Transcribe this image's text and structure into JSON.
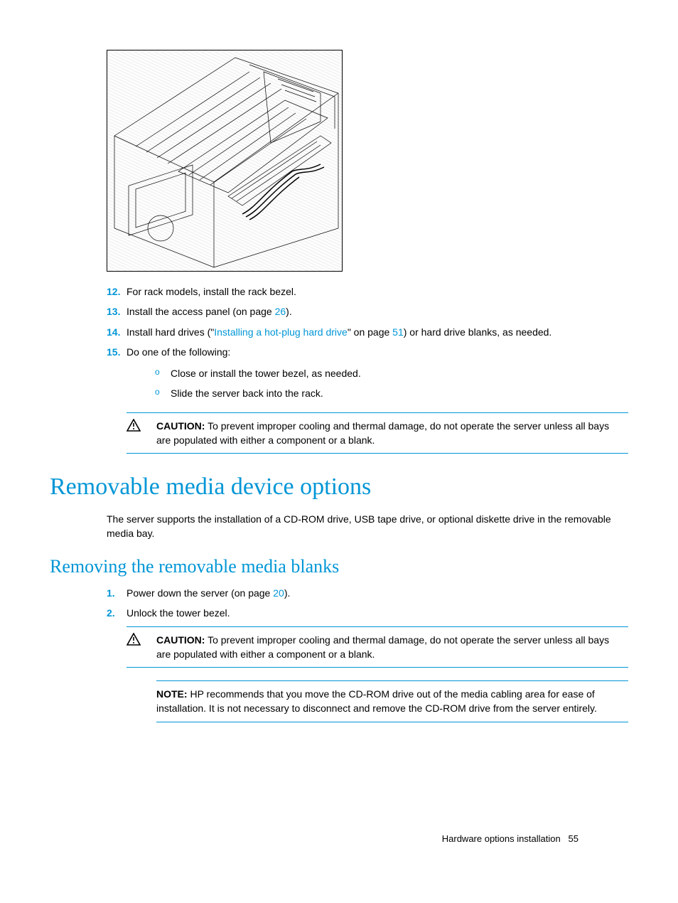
{
  "steps_a": {
    "s12": {
      "num": "12.",
      "text": "For rack models, install the rack bezel."
    },
    "s13": {
      "num": "13.",
      "pre": "Install the access panel (on page ",
      "link": "26",
      "post": ")."
    },
    "s14": {
      "num": "14.",
      "pre": "Install hard drives (\"",
      "link": "Installing a hot-plug hard drive",
      "mid": "\" on page ",
      "link2": "51",
      "post": ") or hard drive blanks, as needed."
    },
    "s15": {
      "num": "15.",
      "text": "Do one of the following:"
    }
  },
  "sub_a": {
    "b": "o",
    "i1": "Close or install the tower bezel, as needed.",
    "i2": "Slide the server back into the rack."
  },
  "caution1": {
    "label": "CAUTION:",
    "text": "To prevent improper cooling and thermal damage, do not operate the server unless all bays are populated with either a component or a blank."
  },
  "h1": "Removable media device options",
  "p1": "The server supports the installation of a CD-ROM drive, USB tape drive, or optional diskette drive in the removable media bay.",
  "h2": "Removing the removable media blanks",
  "steps_b": {
    "s1": {
      "num": "1.",
      "pre": "Power down the server (on page ",
      "link": "20",
      "post": ")."
    },
    "s2": {
      "num": "2.",
      "text": "Unlock the tower bezel."
    }
  },
  "caution2": {
    "label": "CAUTION:",
    "text": "To prevent improper cooling and thermal damage, do not operate the server unless all bays are populated with either a component or a blank."
  },
  "note1": {
    "label": "NOTE:",
    "text": "HP recommends that you move the CD-ROM drive out of the media cabling area for ease of installation. It is not necessary to disconnect and remove the CD-ROM drive from the server entirely."
  },
  "footer": {
    "text": "Hardware options installation",
    "page": "55"
  }
}
